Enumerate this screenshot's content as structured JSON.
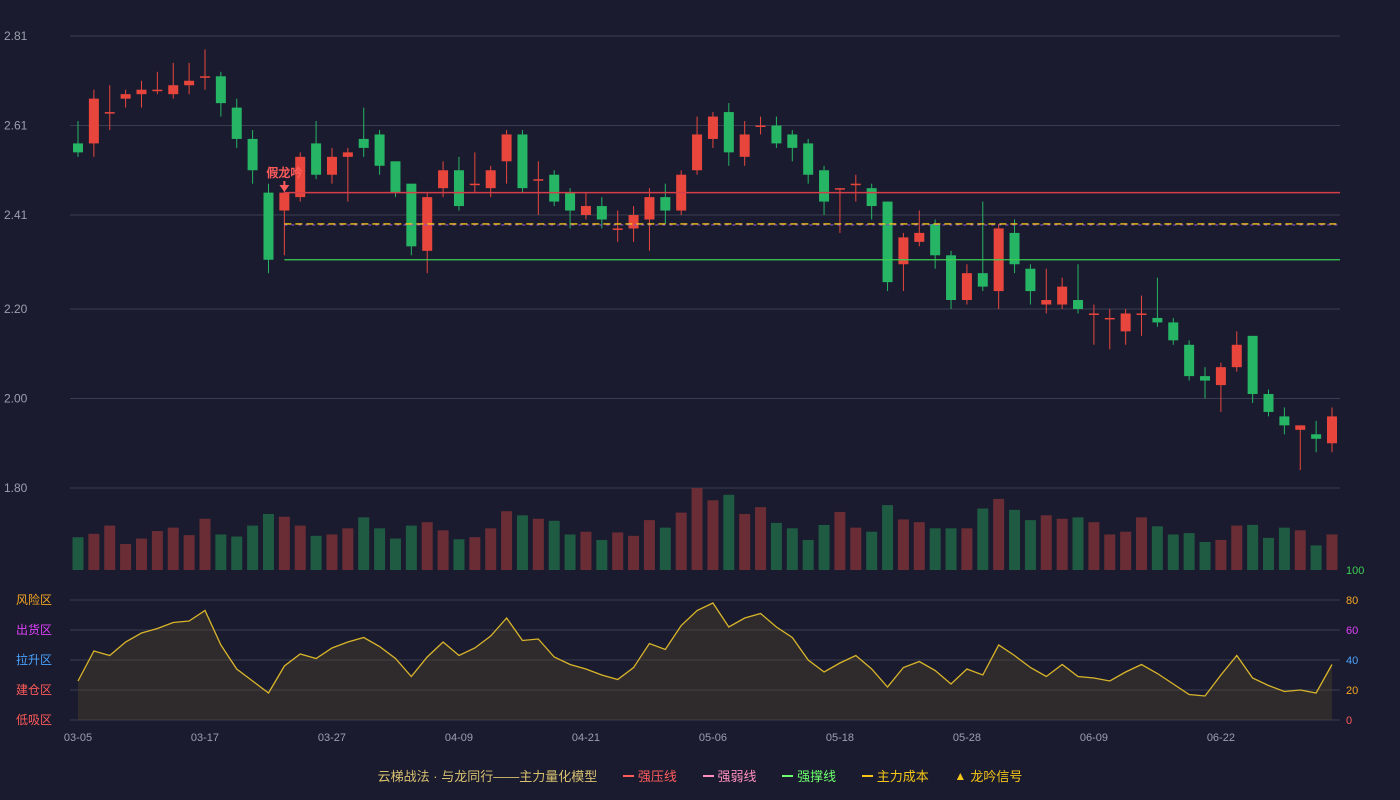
{
  "colors": {
    "background": "#1a1b2e",
    "grid": "#3a3d52",
    "up": "#e8463d",
    "down": "#26b565",
    "vol_up": "#6b2d35",
    "vol_down": "#1f5a42",
    "pressure": "#d43f4a",
    "weak": "#8a4fd0",
    "support": "#3bcf55",
    "cost": "#f5c518",
    "indicator": "#d9b52a",
    "axis_text": "#9aa0ae",
    "signal": "#ff5b5b"
  },
  "legend": {
    "title": "云梯战法 · 与龙同行——主力量化模型",
    "items": [
      {
        "label": "强压线",
        "color": "#ff5b5b",
        "style": "solid"
      },
      {
        "label": "强弱线",
        "color": "#ff8fbf",
        "style": "dash"
      },
      {
        "label": "强撑线",
        "color": "#6dff6d",
        "style": "solid"
      },
      {
        "label": "主力成本",
        "color": "#f5c518",
        "style": "dash"
      },
      {
        "label": "龙吟信号",
        "color": "#f5c518",
        "style": "triangle",
        "glyph": "▲"
      }
    ]
  },
  "chart_data": {
    "type": "candlestick",
    "y_ticks": [
      "2.81",
      "2.61",
      "2.41",
      "2.20",
      "2.00",
      "1.80"
    ],
    "ylim": [
      1.8,
      2.81
    ],
    "x_labels": [
      {
        "index": 0,
        "label": "03-05"
      },
      {
        "index": 8,
        "label": "03-17"
      },
      {
        "index": 16,
        "label": "03-27"
      },
      {
        "index": 24,
        "label": "04-09"
      },
      {
        "index": 32,
        "label": "04-21"
      },
      {
        "index": 40,
        "label": "05-06"
      },
      {
        "index": 48,
        "label": "05-18"
      },
      {
        "index": 56,
        "label": "05-28"
      },
      {
        "index": 64,
        "label": "06-09"
      },
      {
        "index": 72,
        "label": "06-22"
      }
    ],
    "candles": [
      [
        2.57,
        2.55,
        2.62,
        2.54
      ],
      [
        2.57,
        2.67,
        2.69,
        2.54
      ],
      [
        2.64,
        2.64,
        2.7,
        2.6
      ],
      [
        2.67,
        2.68,
        2.69,
        2.65
      ],
      [
        2.68,
        2.69,
        2.71,
        2.65
      ],
      [
        2.69,
        2.69,
        2.73,
        2.68
      ],
      [
        2.68,
        2.7,
        2.75,
        2.67
      ],
      [
        2.7,
        2.71,
        2.75,
        2.68
      ],
      [
        2.72,
        2.72,
        2.78,
        2.69
      ],
      [
        2.72,
        2.66,
        2.73,
        2.63
      ],
      [
        2.65,
        2.58,
        2.67,
        2.56
      ],
      [
        2.58,
        2.51,
        2.6,
        2.48
      ],
      [
        2.46,
        2.31,
        2.48,
        2.28
      ],
      [
        2.42,
        2.46,
        2.47,
        2.32
      ],
      [
        2.45,
        2.54,
        2.55,
        2.44
      ],
      [
        2.57,
        2.5,
        2.62,
        2.49
      ],
      [
        2.5,
        2.54,
        2.56,
        2.48
      ],
      [
        2.54,
        2.55,
        2.56,
        2.44
      ],
      [
        2.58,
        2.56,
        2.65,
        2.54
      ],
      [
        2.59,
        2.52,
        2.6,
        2.5
      ],
      [
        2.53,
        2.46,
        2.53,
        2.45
      ],
      [
        2.48,
        2.34,
        2.48,
        2.32
      ],
      [
        2.33,
        2.45,
        2.46,
        2.28
      ],
      [
        2.47,
        2.51,
        2.53,
        2.45
      ],
      [
        2.51,
        2.43,
        2.54,
        2.42
      ],
      [
        2.48,
        2.48,
        2.55,
        2.46
      ],
      [
        2.47,
        2.51,
        2.52,
        2.45
      ],
      [
        2.53,
        2.59,
        2.6,
        2.48
      ],
      [
        2.59,
        2.47,
        2.6,
        2.46
      ],
      [
        2.49,
        2.49,
        2.53,
        2.41
      ],
      [
        2.5,
        2.44,
        2.51,
        2.43
      ],
      [
        2.46,
        2.42,
        2.47,
        2.38
      ],
      [
        2.41,
        2.43,
        2.46,
        2.4
      ],
      [
        2.43,
        2.4,
        2.45,
        2.38
      ],
      [
        2.38,
        2.38,
        2.42,
        2.35
      ],
      [
        2.38,
        2.41,
        2.43,
        2.35
      ],
      [
        2.4,
        2.45,
        2.47,
        2.33
      ],
      [
        2.45,
        2.42,
        2.48,
        2.39
      ],
      [
        2.42,
        2.5,
        2.51,
        2.41
      ],
      [
        2.51,
        2.59,
        2.63,
        2.5
      ],
      [
        2.58,
        2.63,
        2.64,
        2.56
      ],
      [
        2.64,
        2.55,
        2.66,
        2.52
      ],
      [
        2.54,
        2.59,
        2.62,
        2.52
      ],
      [
        2.61,
        2.61,
        2.63,
        2.59
      ],
      [
        2.61,
        2.57,
        2.63,
        2.56
      ],
      [
        2.59,
        2.56,
        2.6,
        2.53
      ],
      [
        2.57,
        2.5,
        2.58,
        2.48
      ],
      [
        2.51,
        2.44,
        2.52,
        2.41
      ],
      [
        2.47,
        2.47,
        2.47,
        2.37
      ],
      [
        2.48,
        2.48,
        2.5,
        2.44
      ],
      [
        2.47,
        2.43,
        2.48,
        2.4
      ],
      [
        2.44,
        2.26,
        2.44,
        2.24
      ],
      [
        2.3,
        2.36,
        2.37,
        2.24
      ],
      [
        2.35,
        2.37,
        2.42,
        2.34
      ],
      [
        2.39,
        2.32,
        2.4,
        2.29
      ],
      [
        2.32,
        2.22,
        2.33,
        2.2
      ],
      [
        2.22,
        2.28,
        2.3,
        2.21
      ],
      [
        2.28,
        2.25,
        2.44,
        2.24
      ],
      [
        2.24,
        2.38,
        2.39,
        2.2
      ],
      [
        2.37,
        2.3,
        2.4,
        2.28
      ],
      [
        2.29,
        2.24,
        2.3,
        2.21
      ],
      [
        2.21,
        2.22,
        2.29,
        2.19
      ],
      [
        2.21,
        2.25,
        2.27,
        2.2
      ],
      [
        2.22,
        2.2,
        2.3,
        2.19
      ],
      [
        2.19,
        2.19,
        2.21,
        2.12
      ],
      [
        2.18,
        2.18,
        2.2,
        2.11
      ],
      [
        2.15,
        2.19,
        2.2,
        2.12
      ],
      [
        2.19,
        2.19,
        2.23,
        2.14
      ],
      [
        2.18,
        2.17,
        2.27,
        2.16
      ],
      [
        2.17,
        2.13,
        2.18,
        2.12
      ],
      [
        2.12,
        2.05,
        2.13,
        2.04
      ],
      [
        2.05,
        2.04,
        2.07,
        2.0
      ],
      [
        2.03,
        2.07,
        2.08,
        1.97
      ],
      [
        2.07,
        2.12,
        2.15,
        2.06
      ],
      [
        2.14,
        2.01,
        2.14,
        1.99
      ],
      [
        2.01,
        1.97,
        2.02,
        1.96
      ],
      [
        1.96,
        1.94,
        1.98,
        1.92
      ],
      [
        1.93,
        1.94,
        1.94,
        1.84
      ],
      [
        1.92,
        1.91,
        1.95,
        1.88
      ],
      [
        1.9,
        1.96,
        1.98,
        1.88
      ]
    ],
    "pressure_line": {
      "from_index": 13,
      "value": 2.46
    },
    "cost_line": {
      "from_index": 13,
      "value": 2.39
    },
    "weak_line": {
      "from_index": 13,
      "value": 2.39
    },
    "support_line": {
      "from_index": 13,
      "value": 2.31
    },
    "signal": {
      "index": 13,
      "label": "假龙吟"
    },
    "volume": [
      48,
      53,
      65,
      38,
      46,
      57,
      62,
      51,
      75,
      52,
      49,
      65,
      82,
      78,
      65,
      50,
      52,
      61,
      77,
      61,
      46,
      65,
      70,
      58,
      45,
      48,
      61,
      86,
      80,
      75,
      72,
      52,
      56,
      44,
      55,
      50,
      73,
      62,
      84,
      120,
      102,
      110,
      82,
      92,
      69,
      61,
      44,
      66,
      85,
      62,
      56,
      95,
      74,
      70,
      61,
      61,
      61,
      90,
      104,
      88,
      73,
      80,
      75,
      77,
      70,
      52,
      56,
      77,
      64,
      52,
      54,
      41,
      44,
      65,
      66,
      47,
      62,
      58,
      36,
      52
    ],
    "indicator": {
      "y_ticks_left": [
        {
          "label": "风险区",
          "color": "#f5a623"
        },
        {
          "label": "出货区",
          "color": "#e040fb"
        },
        {
          "label": "拉升区",
          "color": "#4aa3ff"
        },
        {
          "label": "建仓区",
          "color": "#ff5b5b"
        },
        {
          "label": "低吸区",
          "color": "#ff5b5b"
        }
      ],
      "y_ticks_right": [
        {
          "label": "100",
          "color": "#3bcf55"
        },
        {
          "label": "80",
          "color": "#f5a623"
        },
        {
          "label": "60",
          "color": "#e040fb"
        },
        {
          "label": "40",
          "color": "#4aa3ff"
        },
        {
          "label": "20",
          "color": "#f5a623"
        },
        {
          "label": "0",
          "color": "#ff5b5b"
        }
      ],
      "ylim": [
        0,
        100
      ],
      "values": [
        26,
        46,
        43,
        52,
        58,
        61,
        65,
        66,
        73,
        50,
        34,
        26,
        18,
        36,
        44,
        41,
        48,
        52,
        55,
        49,
        41,
        29,
        42,
        52,
        43,
        48,
        56,
        68,
        53,
        54,
        42,
        37,
        34,
        30,
        27,
        35,
        51,
        47,
        63,
        73,
        78,
        62,
        68,
        71,
        62,
        55,
        40,
        32,
        38,
        43,
        34,
        22,
        35,
        39,
        33,
        24,
        34,
        30,
        50,
        43,
        35,
        29,
        37,
        29,
        28,
        26,
        32,
        37,
        31,
        24,
        17,
        16,
        30,
        43,
        28,
        23,
        19,
        20,
        18,
        37
      ]
    }
  }
}
